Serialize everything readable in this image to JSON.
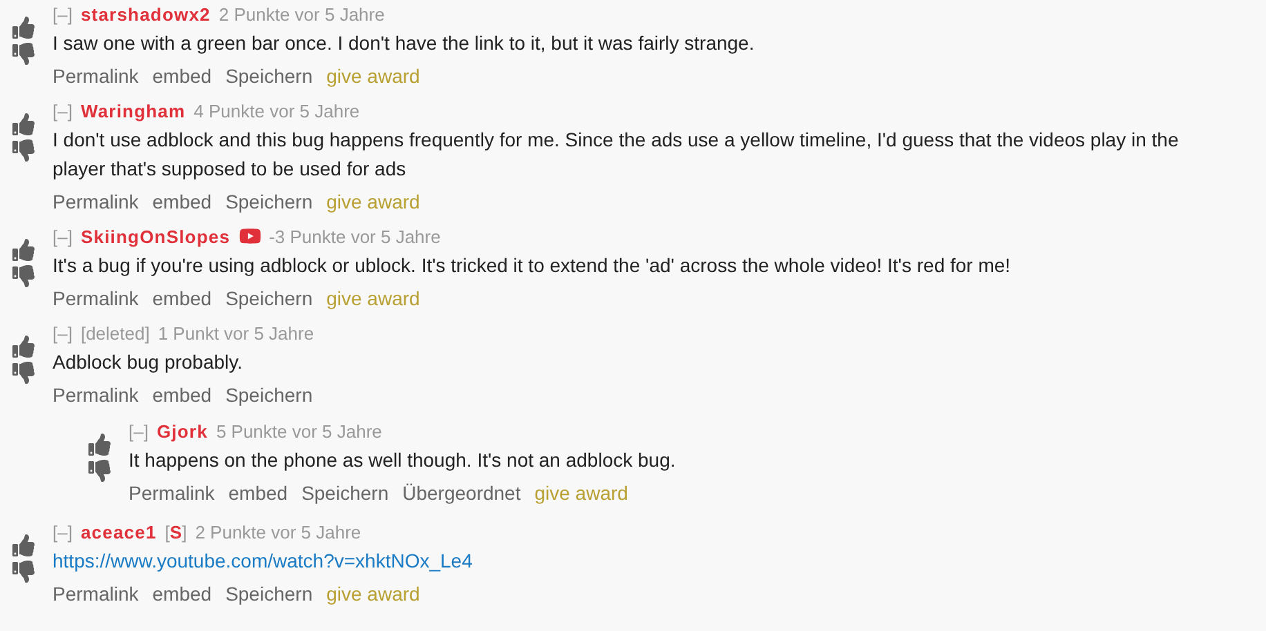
{
  "comments": [
    {
      "collapse": "[–]",
      "author": "starshadowx2",
      "deleted": false,
      "video_flair": false,
      "points": "2 Punkte vor 5 Jahre",
      "body": "I saw one with a green bar once. I don't have the link to it, but it was fairly strange.",
      "actions": [
        {
          "label": "Permalink",
          "kind": "plain"
        },
        {
          "label": "embed",
          "kind": "plain"
        },
        {
          "label": "Speichern",
          "kind": "plain"
        },
        {
          "label": "give award",
          "kind": "award"
        }
      ]
    },
    {
      "collapse": "[–]",
      "author": "Waringham",
      "deleted": false,
      "video_flair": false,
      "points": "4 Punkte vor 5 Jahre",
      "body": "I don't use adblock and this bug happens frequently for me. Since the ads use a yellow timeline, I'd guess that the videos play in the player that's supposed to be used for ads",
      "actions": [
        {
          "label": "Permalink",
          "kind": "plain"
        },
        {
          "label": "embed",
          "kind": "plain"
        },
        {
          "label": "Speichern",
          "kind": "plain"
        },
        {
          "label": "give award",
          "kind": "award"
        }
      ]
    },
    {
      "collapse": "[–]",
      "author": "SkiingOnSlopes",
      "deleted": false,
      "video_flair": true,
      "points": "-3 Punkte vor 5 Jahre",
      "body": "It's a bug if you're using adblock or ublock. It's tricked it to extend the 'ad' across the whole video! It's red for me!",
      "actions": [
        {
          "label": "Permalink",
          "kind": "plain"
        },
        {
          "label": "embed",
          "kind": "plain"
        },
        {
          "label": "Speichern",
          "kind": "plain"
        },
        {
          "label": "give award",
          "kind": "award"
        }
      ]
    },
    {
      "collapse": "[–]",
      "author": "[deleted]",
      "deleted": true,
      "video_flair": false,
      "points": "1 Punkt vor 5 Jahre",
      "body": "Adblock bug probably.",
      "actions": [
        {
          "label": "Permalink",
          "kind": "plain"
        },
        {
          "label": "embed",
          "kind": "plain"
        },
        {
          "label": "Speichern",
          "kind": "plain"
        }
      ],
      "children": [
        {
          "collapse": "[–]",
          "author": "Gjork",
          "deleted": false,
          "video_flair": false,
          "points": "5 Punkte vor 5 Jahre",
          "body": "It happens on the phone as well though. It's not an adblock bug.",
          "actions": [
            {
              "label": "Permalink",
              "kind": "plain"
            },
            {
              "label": "embed",
              "kind": "plain"
            },
            {
              "label": "Speichern",
              "kind": "plain"
            },
            {
              "label": "Übergeordnet",
              "kind": "plain"
            },
            {
              "label": "give award",
              "kind": "award"
            }
          ]
        }
      ]
    },
    {
      "collapse": "[–]",
      "author": "aceace1",
      "deleted": false,
      "video_flair": false,
      "submitter_tag": {
        "open": "[",
        "letter": "S",
        "close": "]"
      },
      "points": "2 Punkte vor 5 Jahre",
      "link": "https://www.youtube.com/watch?v=xhktNOx_Le4",
      "actions": [
        {
          "label": "Permalink",
          "kind": "plain"
        },
        {
          "label": "embed",
          "kind": "plain"
        },
        {
          "label": "Speichern",
          "kind": "plain"
        },
        {
          "label": "give award",
          "kind": "award"
        }
      ]
    }
  ]
}
